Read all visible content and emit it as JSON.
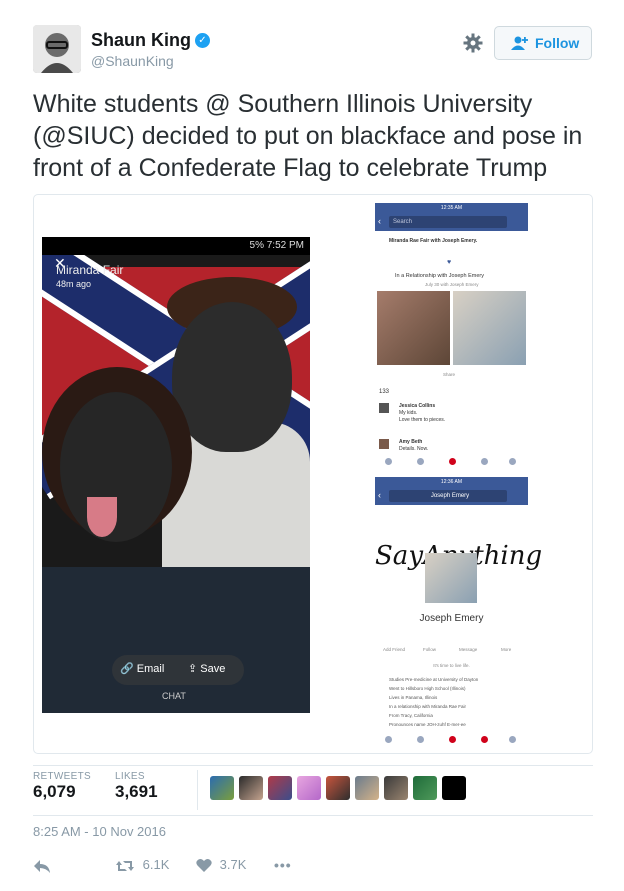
{
  "user": {
    "name": "Shaun King",
    "handle": "@ShaunKing",
    "verified_mark": "✓"
  },
  "follow_button": {
    "label": "Follow"
  },
  "tweet": {
    "text": "White students @ Southern Illinois University (@SIUC) decided to put on blackface and pose in front of a Confederate Flag to celebrate Trump"
  },
  "media": {
    "snapchat": {
      "status_bar": "5%  7:52 PM",
      "sender": "Miranda Fair",
      "age": "48m ago",
      "email_label": "Email",
      "save_label": "Save",
      "chat_label": "CHAT"
    },
    "facebook_1": {
      "status_time": "12:35 AM",
      "search_placeholder": "Search",
      "post_author": "Miranda Rae Fair with Joseph Emery.",
      "relationship": "In a Relationship with Joseph Emery",
      "date": "July 30 with Joseph Emery",
      "share": "Share",
      "reactions_count": "133",
      "comment1_author": "Jessica Collins",
      "comment1_text1": "My kids.",
      "comment1_text2": "Love them to pieces.",
      "comment2_author": "Amy Beth",
      "comment2_text": "Details. Now."
    },
    "facebook_2": {
      "status_time": "12:36 AM",
      "search_value": "Joseph Emery",
      "cover_text": "SayAnything",
      "profile_name": "Joseph Emery",
      "actions": [
        "Add Friend",
        "Follow",
        "Message",
        "More"
      ],
      "bio": "It's time to live life.",
      "details": [
        "Studies Pre-medicine at University of Dayton",
        "Went to Hillsboro High School (Illinois)",
        "Lives in Panama, Illinois",
        "In a relationship with Miranda Rae Fair",
        "From Tracy, California",
        "Pronounces name JOH-zuhf E-mer-ee"
      ]
    }
  },
  "stats": {
    "retweets_label": "RETWEETS",
    "retweets_value": "6,079",
    "likes_label": "LIKES",
    "likes_value": "3,691"
  },
  "timestamp": "8:25 AM - 10 Nov 2016",
  "actions": {
    "reply_icon": "reply-icon",
    "retweet_count": "6.1K",
    "like_count": "3.7K",
    "more_label": "•••"
  },
  "colors": {
    "brand_blue": "#1da1f2",
    "follow_text": "#1c94e0",
    "muted": "#8899a6",
    "facebook_blue": "#3b5998"
  }
}
